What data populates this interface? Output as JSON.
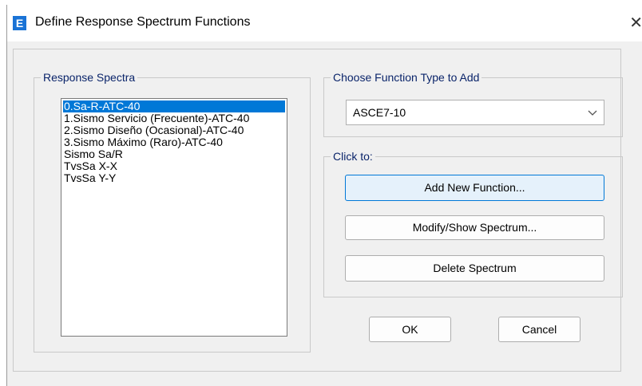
{
  "window": {
    "title": "Define Response Spectrum Functions",
    "app_icon_letter": "E"
  },
  "response_spectra": {
    "label": "Response Spectra",
    "items": [
      "0.Sa-R-ATC-40",
      "1.Sismo Servicio (Frecuente)-ATC-40",
      "2.Sismo Diseño (Ocasional)-ATC-40",
      "3.Sismo Máximo (Raro)-ATC-40",
      "Sismo Sa/R",
      "TvsSa X-X",
      "TvsSa Y-Y"
    ],
    "selected_index": 0
  },
  "function_type": {
    "label": "Choose  Function Type to Add",
    "selected": "ASCE7-10"
  },
  "click_to": {
    "label": "Click to:",
    "add_label": "Add New Function...",
    "modify_label": "Modify/Show Spectrum...",
    "delete_label": "Delete Spectrum"
  },
  "footer": {
    "ok_label": "OK",
    "cancel_label": "Cancel"
  },
  "colors": {
    "selection": "#0078d7",
    "app_icon": "#1a73d6"
  },
  "icons": {
    "app": "etabs-app-icon",
    "close": "close-icon",
    "dropdown": "chevron-down-icon"
  }
}
